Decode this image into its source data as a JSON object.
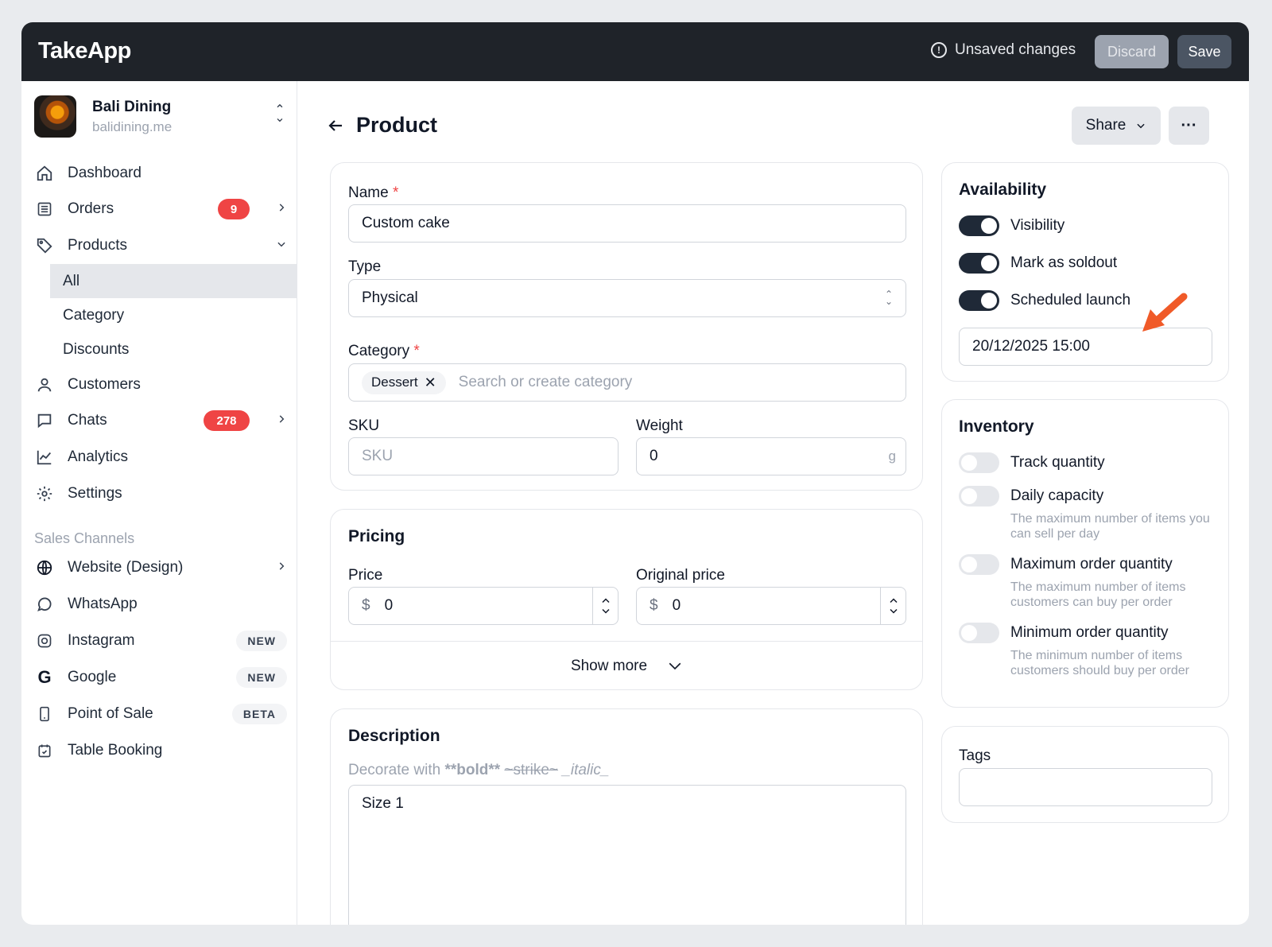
{
  "topbar": {
    "brand": "TakeApp",
    "unsaved": "Unsaved changes",
    "discard": "Discard",
    "save": "Save"
  },
  "store": {
    "name": "Bali Dining",
    "domain": "balidining.me"
  },
  "nav": {
    "dashboard": "Dashboard",
    "orders": "Orders",
    "orders_badge": "9",
    "products": "Products",
    "products_sub": {
      "all": "All",
      "category": "Category",
      "discounts": "Discounts"
    },
    "customers": "Customers",
    "chats": "Chats",
    "chats_badge": "278",
    "analytics": "Analytics",
    "settings": "Settings"
  },
  "sales_channels": {
    "label": "Sales Channels",
    "website": "Website (Design)",
    "whatsapp": "WhatsApp",
    "instagram": "Instagram",
    "instagram_pill": "NEW",
    "google": "Google",
    "google_pill": "NEW",
    "pos": "Point of Sale",
    "pos_pill": "BETA",
    "table_booking": "Table Booking"
  },
  "header": {
    "title": "Product",
    "share": "Share"
  },
  "product": {
    "name_label": "Name",
    "name_value": "Custom cake",
    "type_label": "Type",
    "type_value": "Physical",
    "category_label": "Category",
    "category_tag": "Dessert",
    "category_placeholder": "Search or create category",
    "sku_label": "SKU",
    "sku_placeholder": "SKU",
    "weight_label": "Weight",
    "weight_value": "0",
    "weight_unit": "g"
  },
  "pricing": {
    "title": "Pricing",
    "price_label": "Price",
    "price_currency": "$",
    "price_value": "0",
    "original_label": "Original price",
    "original_currency": "$",
    "original_value": "0",
    "show_more": "Show more"
  },
  "description": {
    "title": "Description",
    "hint_prefix": "Decorate with ",
    "hint_bold": "**bold**",
    "hint_strike": "~strike~",
    "hint_italic": "_italic_",
    "value": "Size 1"
  },
  "availability": {
    "title": "Availability",
    "visibility": "Visibility",
    "soldout": "Mark as soldout",
    "scheduled": "Scheduled launch",
    "datetime": "20/12/2025 15:00"
  },
  "inventory": {
    "title": "Inventory",
    "track": "Track quantity",
    "daily": "Daily capacity",
    "daily_help": "The maximum number of items you can sell per day",
    "max": "Maximum order quantity",
    "max_help": "The maximum number of items customers can buy per order",
    "min": "Minimum order quantity",
    "min_help": "The minimum number of items customers should buy per order"
  },
  "tags": {
    "title": "Tags"
  },
  "colors": {
    "topbar": "#1f2329",
    "accent_arrow": "#f05a28",
    "badge": "#ef4444"
  }
}
